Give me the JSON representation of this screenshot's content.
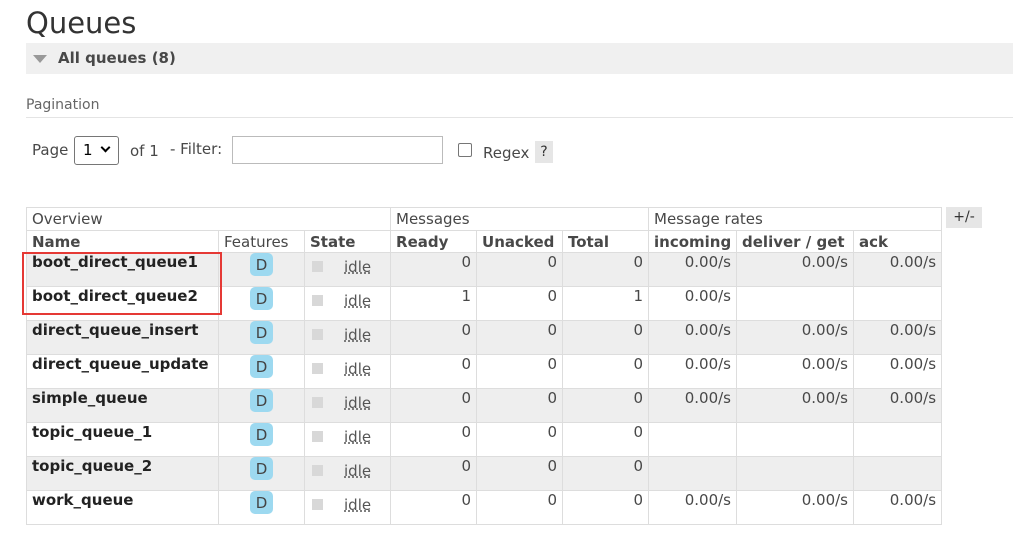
{
  "page_title": "Queues",
  "section": {
    "label": "All queues (8)"
  },
  "pagination": {
    "label": "Pagination",
    "page_label": "Page",
    "page_value": "1",
    "of_label": "of 1",
    "filter_label": "- Filter:",
    "filter_value": "",
    "regex_label": "Regex",
    "help_label": "?"
  },
  "columns_toggle": "+/-",
  "table": {
    "groups": [
      "Overview",
      "Messages",
      "Message rates"
    ],
    "headers": [
      "Name",
      "Features",
      "State",
      "Ready",
      "Unacked",
      "Total",
      "incoming",
      "deliver / get",
      "ack"
    ],
    "rows": [
      {
        "name": "boot_direct_queue1",
        "feature": "D",
        "state": "idle",
        "ready": "0",
        "unacked": "0",
        "total": "0",
        "incoming": "0.00/s",
        "deliver": "0.00/s",
        "ack": "0.00/s"
      },
      {
        "name": "boot_direct_queue2",
        "feature": "D",
        "state": "idle",
        "ready": "1",
        "unacked": "0",
        "total": "1",
        "incoming": "0.00/s",
        "deliver": "",
        "ack": ""
      },
      {
        "name": "direct_queue_insert",
        "feature": "D",
        "state": "idle",
        "ready": "0",
        "unacked": "0",
        "total": "0",
        "incoming": "0.00/s",
        "deliver": "0.00/s",
        "ack": "0.00/s"
      },
      {
        "name": "direct_queue_update",
        "feature": "D",
        "state": "idle",
        "ready": "0",
        "unacked": "0",
        "total": "0",
        "incoming": "0.00/s",
        "deliver": "0.00/s",
        "ack": "0.00/s"
      },
      {
        "name": "simple_queue",
        "feature": "D",
        "state": "idle",
        "ready": "0",
        "unacked": "0",
        "total": "0",
        "incoming": "0.00/s",
        "deliver": "0.00/s",
        "ack": "0.00/s"
      },
      {
        "name": "topic_queue_1",
        "feature": "D",
        "state": "idle",
        "ready": "0",
        "unacked": "0",
        "total": "0",
        "incoming": "",
        "deliver": "",
        "ack": ""
      },
      {
        "name": "topic_queue_2",
        "feature": "D",
        "state": "idle",
        "ready": "0",
        "unacked": "0",
        "total": "0",
        "incoming": "",
        "deliver": "",
        "ack": ""
      },
      {
        "name": "work_queue",
        "feature": "D",
        "state": "idle",
        "ready": "0",
        "unacked": "0",
        "total": "0",
        "incoming": "0.00/s",
        "deliver": "0.00/s",
        "ack": "0.00/s"
      }
    ]
  },
  "colors": {
    "highlight": "#e53935",
    "badge": "#9dd9f0",
    "row_alt": "#eeeeee"
  },
  "icons": {
    "section_toggle": "triangle-down-icon",
    "select_chevron": "chevron-down-icon",
    "state": "state-square-icon"
  }
}
